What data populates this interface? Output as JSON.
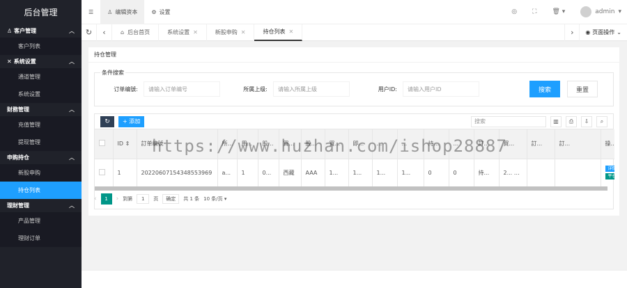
{
  "app": {
    "title": "后台管理"
  },
  "sidebar": {
    "groups": [
      {
        "icon": "user-icon",
        "title": "客户管理",
        "items": [
          {
            "label": "客户列表",
            "active": false
          }
        ]
      },
      {
        "icon": "tools-icon",
        "title": "系统设置",
        "items": [
          {
            "label": "通道管理",
            "active": false
          },
          {
            "label": "系统设置",
            "active": false
          }
        ]
      },
      {
        "icon": "",
        "title": "财務管理",
        "items": [
          {
            "label": "充值管理",
            "active": false
          },
          {
            "label": "提现管理",
            "active": false
          }
        ]
      },
      {
        "icon": "",
        "title": "申购持仓",
        "items": [
          {
            "label": "新股申购",
            "active": false
          },
          {
            "label": "持仓列表",
            "active": true
          }
        ]
      },
      {
        "icon": "",
        "title": "理財管理",
        "items": [
          {
            "label": "产品管理",
            "active": false
          },
          {
            "label": "理财订单",
            "active": false
          }
        ]
      }
    ]
  },
  "header": {
    "menu_icon": "menu-icon",
    "btn_info": "编辑资本",
    "btn_settings": "设置",
    "user": "admin"
  },
  "tabs": {
    "home": "后台首页",
    "items": [
      "系统设置",
      "新股申购",
      "持仓列表"
    ],
    "page_ops": "页面操作"
  },
  "card": {
    "title": "持仓管理"
  },
  "search": {
    "legend": "条件搜索",
    "fields": [
      {
        "label": "订单编號:",
        "placeholder": "请输入订单编号"
      },
      {
        "label": "所属上级:",
        "placeholder": "请输入所属上级"
      },
      {
        "label": "用户ID:",
        "placeholder": "请输入用户ID"
      }
    ],
    "search_btn": "搜索",
    "reset_btn": "重置"
  },
  "table": {
    "add_btn": "+ 添加",
    "search_placeholder": "搜索",
    "columns": [
      "ID ⇕",
      "訂单编號",
      "所...",
      "用...",
      "股票...",
      "買入...",
      "股票名称",
      "買...",
      "即...",
      "...",
      "...",
      "持...",
      "...",
      "訂...",
      "買...",
      "訂...",
      "訂...",
      "操作"
    ],
    "rows": [
      {
        "cells": [
          "1",
          "20220607154348553969",
          "a...",
          "1",
          "0...",
          "西藏",
          "AAA",
          "1...",
          "1...",
          "1...",
          "1...",
          "0",
          "0",
          "持...",
          "2... 1...",
          "",
          ""
        ],
        "actions": [
          "详情",
          "平仓"
        ]
      }
    ]
  },
  "pager": {
    "current": "1",
    "goto_label": "到第",
    "page_value": "1",
    "page_unit": "页",
    "confirm": "确定",
    "total": "共 1 条",
    "per_page": "10 条/页 ▾"
  },
  "watermark": "https://www.huzhan.com/ishop28887"
}
